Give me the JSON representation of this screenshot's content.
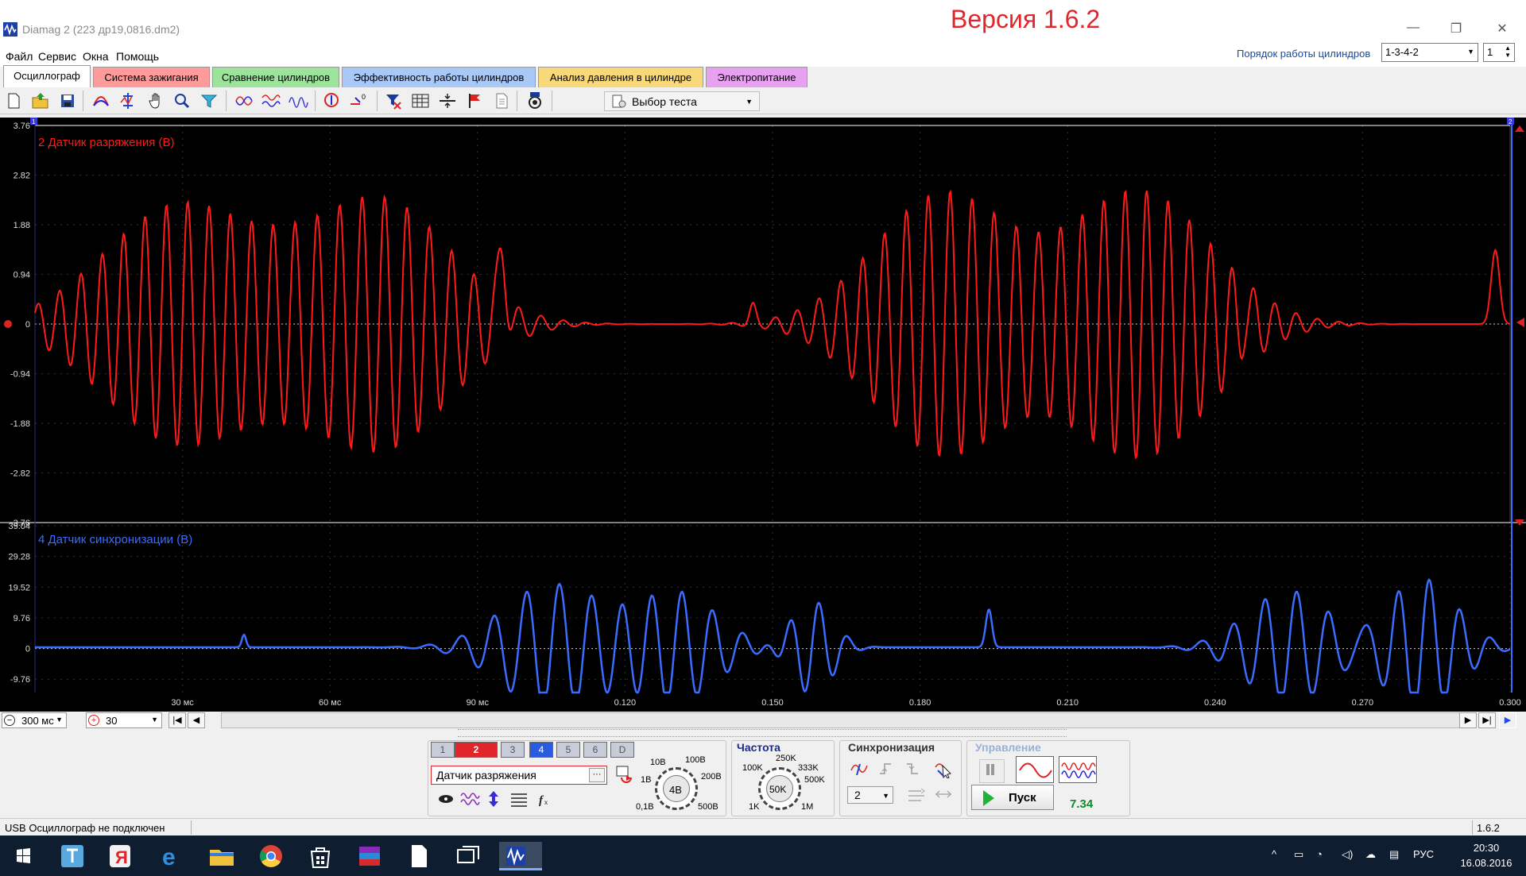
{
  "window": {
    "title": "Diamag 2 (223 др19,0816.dm2)",
    "version_banner": "Версия 1.6.2",
    "minimize": "—",
    "restore": "❐",
    "close": "✕"
  },
  "menu": [
    "Файл",
    "Сервис",
    "Окна",
    "Помощь"
  ],
  "cylinder_order": {
    "label": "Порядок работы цилиндров",
    "value": "1-3-4-2",
    "cylinder": "1"
  },
  "tabs": [
    {
      "label": "Осциллограф",
      "color": "#f0f0f0",
      "active": true
    },
    {
      "label": "Система зажигания",
      "color": "#ff9b9b"
    },
    {
      "label": "Сравнение цилиндров",
      "color": "#9ce39c"
    },
    {
      "label": "Эффективность работы цилиндров",
      "color": "#a8c8f8"
    },
    {
      "label": "Анализ давления в цилиндре",
      "color": "#f8d878"
    },
    {
      "label": "Электропитание",
      "color": "#e8a0f0"
    }
  ],
  "toolbar": {
    "test_select": "Выбор теста",
    "icons": [
      "new-file-icon",
      "open-folder-icon",
      "save-icon",
      "channel-a-icon",
      "cursor-measure-icon",
      "hand-pan-icon",
      "zoom-icon",
      "filter-icon",
      "compare-icon",
      "overlay-icon",
      "waveforms-icon",
      "auto-scale-icon",
      "zero-level-icon",
      "trigger-icon",
      "grid-icon",
      "split-icon",
      "marker-flag-icon",
      "report-icon",
      "auto-settings-icon"
    ]
  },
  "scope": {
    "channel_a": {
      "title": "2 Датчик разряжения (В)",
      "color": "#ff1a1a",
      "y_ticks": [
        "3.76",
        "2.82",
        "1.88",
        "0.94",
        "0",
        "-0.94",
        "-1.88",
        "-2.82",
        "-3.76"
      ],
      "ylim": [
        -3.76,
        3.76
      ]
    },
    "channel_b": {
      "title": "4 Датчик синхронизации (В)",
      "color": "#3b6cff",
      "y_ticks": [
        "39.04",
        "29.28",
        "19.52",
        "9.76",
        "0",
        "-9.76"
      ],
      "ylim": [
        -14,
        39.04
      ]
    },
    "x_ticks": [
      "30 мс",
      "60 мс",
      "90 мс",
      "0.120",
      "0.150",
      "0.180",
      "0.210",
      "0.240",
      "0.270",
      "0.300"
    ],
    "x_range_s": [
      0,
      0.3
    ],
    "marker_top_left": "1",
    "marker_top_right": "2"
  },
  "timebase": {
    "value": "300 мс",
    "zoom": "30"
  },
  "controls": {
    "channels": [
      "1",
      "2",
      "3",
      "4",
      "5",
      "6",
      "D"
    ],
    "active_channels": [
      "2",
      "4"
    ],
    "sensor_name": "Датчик разряжения",
    "voltage_dial": {
      "value": "4В",
      "labels": [
        "10В",
        "100В",
        "1В",
        "200В",
        "0,1В",
        "500В"
      ]
    },
    "frequency": {
      "title": "Частота",
      "value": "50K",
      "labels": [
        "250K",
        "100K",
        "333K",
        "500K",
        "1K",
        "1M"
      ]
    },
    "sync": {
      "title": "Синхронизация",
      "channel": "2"
    },
    "control": {
      "title": "Управление",
      "start": "Пуск",
      "counter": "7.34"
    }
  },
  "status": {
    "text": "USB Осциллограф не подключен",
    "version": "1.6.2"
  },
  "taskbar": {
    "lang": "РУС",
    "time": "20:30",
    "date": "16.08.2016",
    "apps": [
      "start-icon",
      "app-icon",
      "yandex-browser-icon",
      "edge-icon",
      "explorer-icon",
      "chrome-icon",
      "store-icon",
      "winrar-icon",
      "document-icon",
      "taskview-icon",
      "diamag-icon"
    ]
  }
}
